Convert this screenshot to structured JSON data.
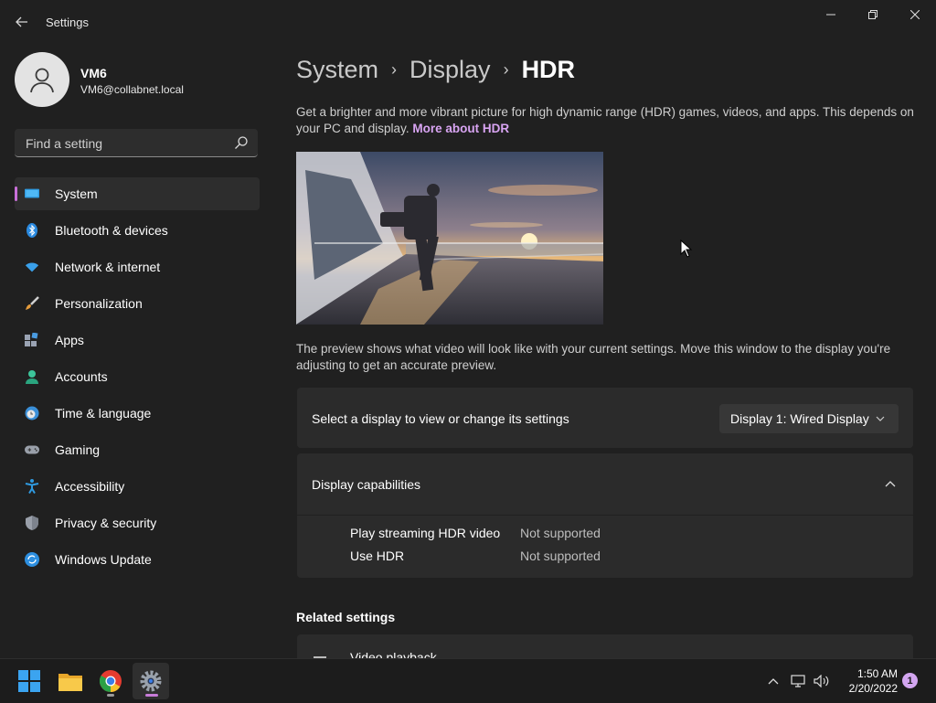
{
  "window": {
    "title": "Settings",
    "controls": {
      "minimize": "minimize-icon",
      "maximize": "restore-icon",
      "close": "close-icon"
    }
  },
  "profile": {
    "name": "VM6",
    "email": "VM6@collabnet.local"
  },
  "search": {
    "placeholder": "Find a setting"
  },
  "nav": {
    "items": [
      {
        "label": "System",
        "icon": "system-display-icon",
        "active": true
      },
      {
        "label": "Bluetooth & devices",
        "icon": "bluetooth-icon"
      },
      {
        "label": "Network & internet",
        "icon": "wifi-icon"
      },
      {
        "label": "Personalization",
        "icon": "brush-icon"
      },
      {
        "label": "Apps",
        "icon": "apps-icon"
      },
      {
        "label": "Accounts",
        "icon": "accounts-icon"
      },
      {
        "label": "Time & language",
        "icon": "globe-clock-icon"
      },
      {
        "label": "Gaming",
        "icon": "gamepad-icon"
      },
      {
        "label": "Accessibility",
        "icon": "accessibility-icon"
      },
      {
        "label": "Privacy & security",
        "icon": "shield-icon"
      },
      {
        "label": "Windows Update",
        "icon": "update-icon"
      }
    ]
  },
  "breadcrumb": {
    "level1": "System",
    "level2": "Display",
    "current": "HDR"
  },
  "content": {
    "description": "Get a brighter and more vibrant picture for high dynamic range (HDR) games, videos, and apps. This depends on your PC and display.",
    "link": "More about HDR",
    "preview_note": "The preview shows what video will look like with your current settings. Move this window to the display you're adjusting to get an accurate preview."
  },
  "display_select": {
    "label": "Select a display to view or change its settings",
    "selected": "Display 1: Wired Display"
  },
  "capabilities": {
    "title": "Display capabilities",
    "rows": [
      {
        "name": "Play streaming HDR video",
        "value": "Not supported"
      },
      {
        "name": "Use HDR",
        "value": "Not supported"
      }
    ]
  },
  "related": {
    "title": "Related settings",
    "first_item": "Video playback"
  },
  "taskbar": {
    "apps": [
      "start-icon",
      "file-explorer-icon",
      "chrome-icon",
      "settings-icon"
    ],
    "time": "1:50 AM",
    "date": "2/20/2022",
    "notifications": "1"
  },
  "colors": {
    "accent": "#c86fd8",
    "link": "#d8a4f2",
    "background": "#202020",
    "card": "#2b2b2b"
  }
}
